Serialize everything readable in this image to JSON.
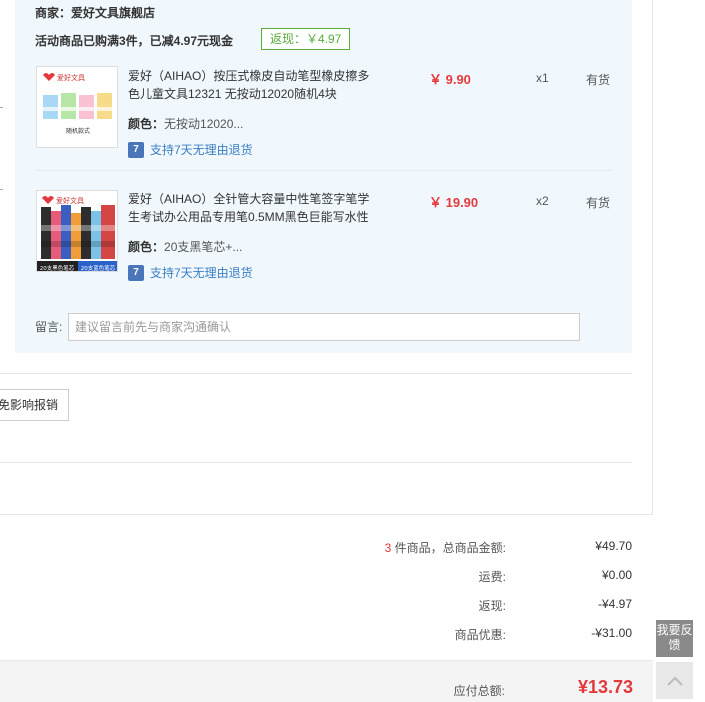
{
  "shop": {
    "name": "商家：爱好文具旗舰店",
    "promo_text": "活动商品已购满3件，已减4.97元现金",
    "cashback_tag": "返现：￥4.97"
  },
  "items": [
    {
      "thumb_brand": "爱好文具",
      "thumb_caption": "随机款式",
      "title": "爱好（AIHAO）按压式橡皮自动笔型橡皮擦多色儿童文具12321 无按动12020随机4块",
      "color_label": "颜色：",
      "color_value": "无按动12020...",
      "return_policy": "支持7天无理由退货",
      "price": "￥ 9.90",
      "qty": "x1",
      "stock": "有货"
    },
    {
      "thumb_brand": "爱好文具",
      "thumb_caption_left": "20支黑色笔芯",
      "thumb_caption_right": "20支蓝色笔芯",
      "title": "爱好（AIHAO）全针管大容量中性笔签字笔学生考试办公用品专用笔0.5MM黑色巨能写水性",
      "color_label": "颜色：",
      "color_value": "20支黑笔芯+...",
      "return_policy": "支持7天无理由退货",
      "price": "￥ 19.90",
      "qty": "x2",
      "stock": "有货"
    }
  ],
  "message": {
    "label": "留言:",
    "placeholder": "建议留言前先与商家沟通确认"
  },
  "invoice": {
    "button_label": "免影响报销"
  },
  "summary": {
    "count": "3",
    "goods_total_label": " 件商品，总商品金额:",
    "goods_total_value": "¥49.70",
    "shipping_label": "运费:",
    "shipping_value": "¥0.00",
    "cashback_label": "返现:",
    "cashback_value": "-¥4.97",
    "discount_label": "商品优惠:",
    "discount_value": "-¥31.00",
    "payable_label": "应付总额:",
    "payable_value": "¥13.73"
  },
  "side_tools": {
    "feedback_label": "我要反馈"
  },
  "colors": {
    "accent_red": "#e4393c",
    "cashback_green": "#5aab3c",
    "shop_bg": "#f1f8fd"
  }
}
